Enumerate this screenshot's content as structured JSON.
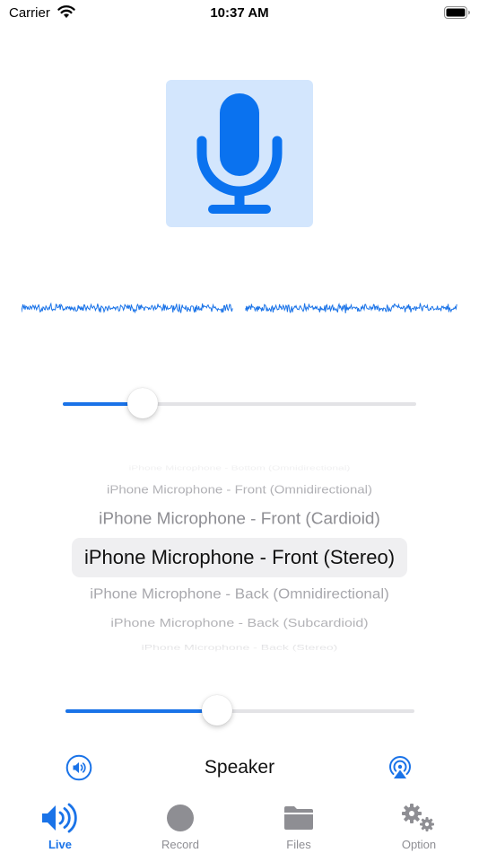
{
  "status_bar": {
    "carrier": "Carrier",
    "time": "10:37 AM"
  },
  "accent_color": "#1a73e8",
  "mic_button": {
    "icon": "microphone-icon",
    "background": "#d3e6fd"
  },
  "gain_slider": {
    "value": 0.2
  },
  "input_picker": {
    "options": [
      "iPhone Microphone - Bottom (Omnidirectional)",
      "iPhone Microphone - Front (Omnidirectional)",
      "iPhone Microphone - Front (Cardioid)",
      "iPhone Microphone - Front (Stereo)",
      "iPhone Microphone - Back (Omnidirectional)",
      "iPhone Microphone - Back (Subcardioid)",
      "iPhone Microphone - Back (Stereo)"
    ],
    "selected": "iPhone Microphone - Front (Stereo)"
  },
  "volume_slider": {
    "value": 0.41
  },
  "output": {
    "label": "Speaker",
    "speaker_icon": "speaker-icon",
    "route_icon": "airplay-icon"
  },
  "tabs": [
    {
      "label": "Live",
      "icon": "speaker-wave-icon",
      "active": true
    },
    {
      "label": "Record",
      "icon": "record-icon",
      "active": false
    },
    {
      "label": "Files",
      "icon": "folder-icon",
      "active": false
    },
    {
      "label": "Option",
      "icon": "gears-icon",
      "active": false
    }
  ]
}
